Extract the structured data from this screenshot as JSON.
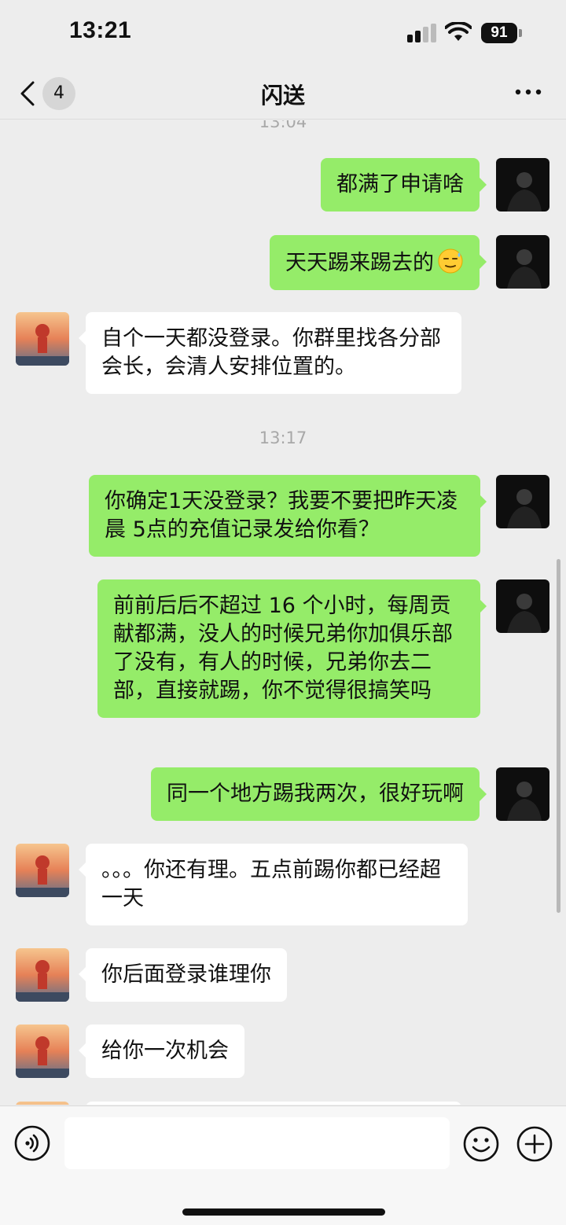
{
  "status_bar": {
    "time": "13:21",
    "battery": "91"
  },
  "nav": {
    "unread_count": "4",
    "title": "闪送"
  },
  "chat": {
    "timestamps": [
      "13:04",
      "13:17"
    ],
    "messages": [
      {
        "sender": "me",
        "text": "都满了申请啥"
      },
      {
        "sender": "me",
        "text": "天天踢来踢去的",
        "emoji": "sweat-smile-emoji"
      },
      {
        "sender": "other",
        "text": "自个一天都没登录。你群里找各分部会长，会清人安排位置的。"
      },
      {
        "sender": "me",
        "text": "你确定1天没登录？我要不要把昨天凌晨 5点的充值记录发给你看？"
      },
      {
        "sender": "me",
        "text": "前前后后不超过 16 个小时，每周贡献都满，没人的时候兄弟你加俱乐部了没有，有人的时候，兄弟你去二部，直接就踢，你不觉得很搞笑吗"
      },
      {
        "sender": "me",
        "text": "同一个地方踢我两次，很好玩啊"
      },
      {
        "sender": "other",
        "text": "。。。你还有理。五点前踢你都已经超一天"
      },
      {
        "sender": "other",
        "text": "你后面登录谁理你"
      },
      {
        "sender": "other",
        "text": "给你一次机会"
      }
    ]
  },
  "input_bar": {
    "placeholder": "",
    "value": ""
  },
  "colors": {
    "bubble_me": "#95ec69",
    "bubble_other": "#ffffff",
    "background": "#ededed"
  },
  "icons": {
    "back": "chevron-left-icon",
    "more": "more-dots-icon",
    "voice": "voice-icon",
    "emoji": "emoji-face-icon",
    "plus": "plus-icon"
  }
}
